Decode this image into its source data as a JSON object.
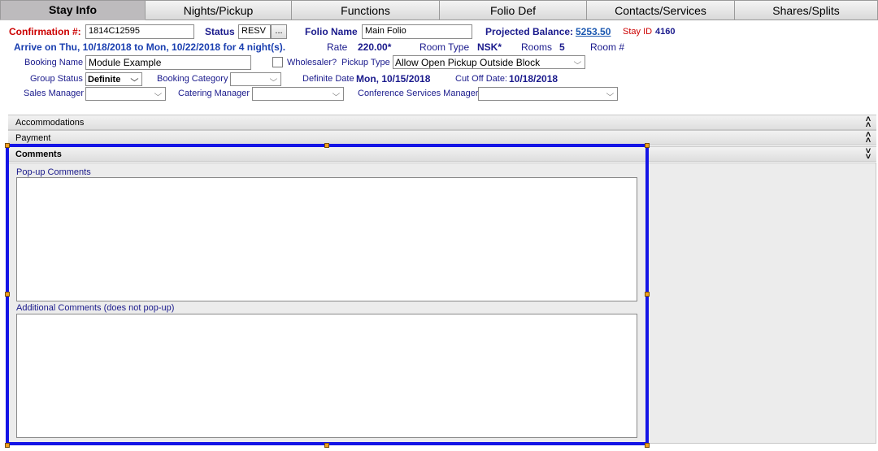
{
  "tabs": [
    "Stay Info",
    "Nights/Pickup",
    "Functions",
    "Folio Def",
    "Contacts/Services",
    "Shares/Splits"
  ],
  "header": {
    "confirmation_label": "Confirmation #:",
    "confirmation_value": "1814C12595",
    "status_label": "Status",
    "status_value": "RESV",
    "status_button": "...",
    "folio_name_label": "Folio Name",
    "folio_name_value": "Main Folio",
    "projected_balance_label": "Projected Balance:",
    "projected_balance_value": "5253.50",
    "stay_id_label": "Stay ID",
    "stay_id_value": "4160"
  },
  "stay": {
    "arrive_text": "Arrive on Thu, 10/18/2018 to Mon, 10/22/2018 for 4 night(s).",
    "rate_label": "Rate",
    "rate_value": "220.00*",
    "room_type_label": "Room Type",
    "room_type_value": "NSK*",
    "rooms_label": "Rooms",
    "rooms_value": "5",
    "room_num_label": "Room #"
  },
  "booking": {
    "booking_name_label": "Booking Name",
    "booking_name_value": "Module Example",
    "wholesaler_label": "Wholesaler?",
    "pickup_type_label": "Pickup Type",
    "pickup_type_value": "Allow Open Pickup Outside Block",
    "group_status_label": "Group Status",
    "group_status_value": "Definite",
    "booking_category_label": "Booking Category",
    "booking_category_value": "",
    "definite_date_label": "Definite Date",
    "definite_date_value": "Mon, 10/15/2018",
    "cutoff_label": "Cut Off Date:",
    "cutoff_value": "10/18/2018",
    "sales_manager_label": "Sales Manager",
    "sales_manager_value": "",
    "catering_manager_label": "Catering Manager",
    "catering_manager_value": "",
    "conference_manager_label": "Conference Services Manager",
    "conference_manager_value": ""
  },
  "panels": {
    "accommodations": "Accommodations",
    "payment": "Payment",
    "comments": "Comments",
    "popup_comments_label": "Pop-up Comments",
    "additional_comments_label": "Additional Comments (does not pop-up)"
  },
  "icons": {
    "collapse": "double-chevron-up-icon",
    "expand": "double-chevron-down-icon",
    "dropdown": "chevron-down-icon"
  },
  "colors": {
    "label_blue": "#1a1a8c",
    "confirmation_red": "#cc0000",
    "selection_blue": "#1414e6",
    "handle_orange": "#f0a020"
  }
}
